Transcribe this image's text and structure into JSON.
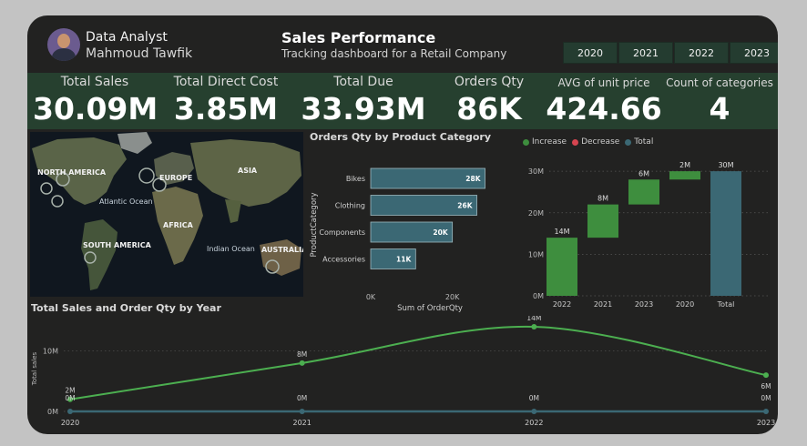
{
  "header": {
    "role": "Data Analyst",
    "name": "Mahmoud Tawfik",
    "title": "Sales Performance",
    "subtitle": "Tracking dashboard for a Retail Company",
    "years": [
      "2020",
      "2021",
      "2022",
      "2023"
    ]
  },
  "kpis": [
    {
      "label": "Total Sales",
      "value": "30.09M"
    },
    {
      "label": "Total Direct Cost",
      "value": "3.85M"
    },
    {
      "label": "Total Due",
      "value": "33.93M"
    },
    {
      "label": "Orders Qty",
      "value": "86K"
    },
    {
      "label": "AVG of unit price",
      "value": "424.66"
    },
    {
      "label": "Count of categories",
      "value": "4"
    }
  ],
  "map": {
    "labels": {
      "north_america": "NORTH AMERICA",
      "europe": "EUROPE",
      "asia": "ASIA",
      "africa": "AFRICA",
      "south_america": "SOUTH AMERICA",
      "australia": "AUSTRALIA",
      "atlantic": "Atlantic Ocean",
      "indian": "Indian Ocean"
    }
  },
  "colors": {
    "increase": "#3e8e3e",
    "decrease": "#d64550",
    "total": "#3b6874",
    "bar": "#3b6874",
    "line": "#4caf50",
    "kpi_band": "#26402f"
  },
  "chart_data": [
    {
      "type": "bar",
      "orientation": "horizontal",
      "title": "Orders Qty by Product Category",
      "xlabel": "Sum of OrderQty",
      "ylabel": "ProductCategory",
      "categories": [
        "Bikes",
        "Clothing",
        "Components",
        "Accessories"
      ],
      "values": [
        28,
        26,
        20,
        11
      ],
      "data_labels": [
        "28K",
        "26K",
        "20K",
        "11K"
      ],
      "xticks": [
        "0K",
        "20K"
      ],
      "xlim": [
        0,
        29
      ]
    },
    {
      "type": "bar",
      "subtype": "waterfall",
      "legend": [
        "Increase",
        "Decrease",
        "Total"
      ],
      "categories": [
        "2022",
        "2021",
        "2023",
        "2020",
        "Total"
      ],
      "values": [
        14,
        8,
        6,
        2,
        30
      ],
      "kinds": [
        "increase",
        "increase",
        "increase",
        "increase",
        "total"
      ],
      "data_labels": [
        "14M",
        "8M",
        "6M",
        "2M",
        "30M"
      ],
      "yticks": [
        "0M",
        "10M",
        "20M",
        "30M"
      ],
      "ylim": [
        0,
        32
      ]
    },
    {
      "type": "line",
      "title": "Total Sales and Order Qty by Year",
      "ylabel": "Total sales",
      "x": [
        "2020",
        "2021",
        "2022",
        "2023"
      ],
      "series": [
        {
          "values": [
            2,
            8,
            14,
            6
          ],
          "labels": [
            "2M",
            "8M",
            "14M",
            "6M"
          ]
        },
        {
          "values": [
            0,
            0,
            0,
            0
          ],
          "labels": [
            "0M",
            "0M",
            "0M",
            "0M"
          ]
        }
      ],
      "yticks": [
        "0M",
        "10M"
      ],
      "ylim": [
        0,
        14
      ]
    }
  ]
}
